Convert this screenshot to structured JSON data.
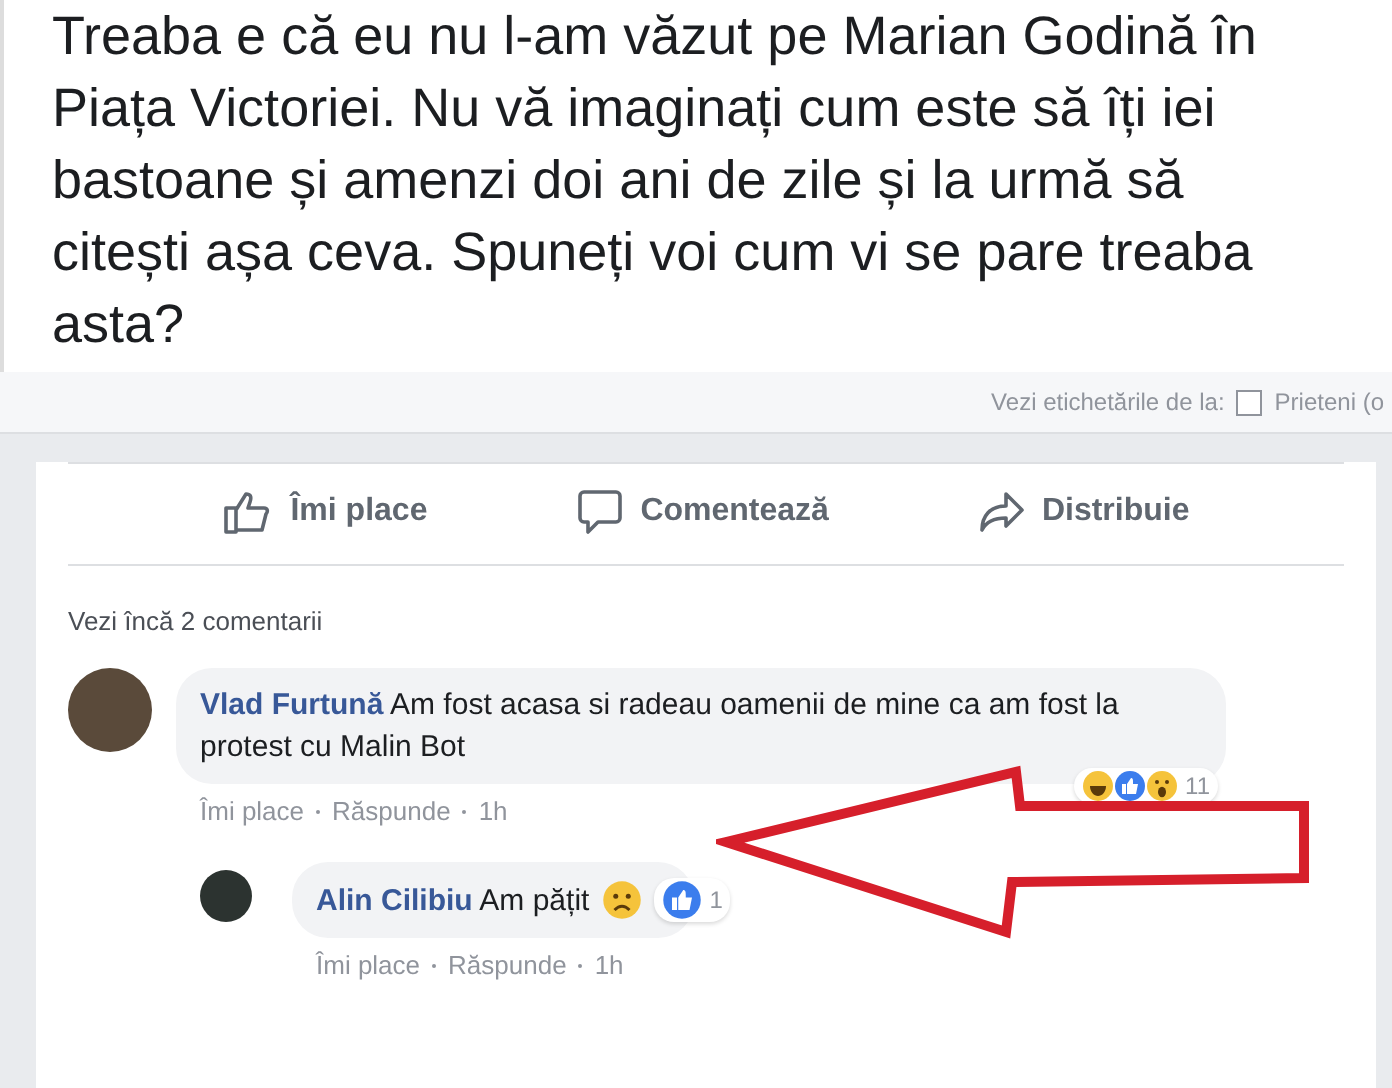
{
  "post": {
    "text": "Treaba e că eu nu l-am văzut pe Marian Godină în Piața Victoriei. Nu vă imaginați cum este să îți iei bastoane și amenzi doi ani de zile și la urmă să citești așa ceva. Spuneți voi cum vi se pare treaba asta?"
  },
  "tag_bar": {
    "label": "Vezi etichetările de la:",
    "option": "Prieteni (o",
    "checked": false
  },
  "actions": [
    {
      "kind": "like",
      "label": "Îmi place"
    },
    {
      "kind": "comment",
      "label": "Comentează"
    },
    {
      "kind": "share",
      "label": "Distribuie"
    }
  ],
  "more_comments": "Vezi încă 2 comentarii",
  "comments": [
    {
      "name": "Vlad Furtună",
      "text": "Am fost acasa si radeau oamenii de mine ca am fost la protest cu Malin Bot",
      "reactions": [
        {
          "kind": "haha"
        },
        {
          "kind": "like"
        },
        {
          "kind": "wow"
        }
      ],
      "reaction_count": "11",
      "like": "Îmi place",
      "reply": "Răspunde",
      "time": "1h",
      "children": [
        {
          "name": "Alin Cilibiu",
          "text": "Am pățit",
          "text_icon": {
            "kind": "sad"
          },
          "reactions": [
            {
              "kind": "like"
            }
          ],
          "reaction_count": "1",
          "like": "Îmi place",
          "reply": "Răspunde",
          "time": "1h"
        }
      ]
    }
  ]
}
